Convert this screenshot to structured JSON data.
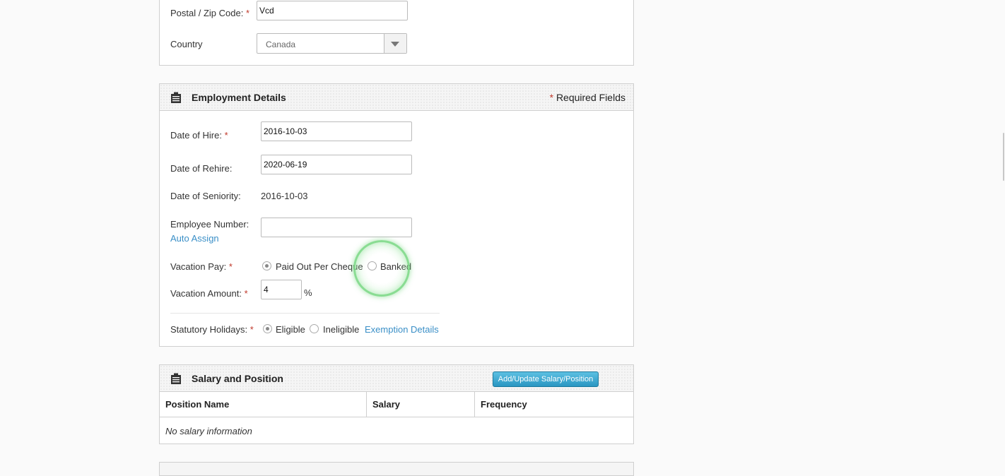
{
  "address": {
    "postal_label": "Postal / Zip Code:",
    "postal_value": "Vcd",
    "country_label": "Country",
    "country_value": "Canada"
  },
  "employment": {
    "title": "Employment Details",
    "required_note": "Required Fields",
    "required_star": "*",
    "hire_label": "Date of Hire:",
    "hire_value": "2016-10-03",
    "rehire_label": "Date of Rehire:",
    "rehire_value": "2020-06-19",
    "seniority_label": "Date of Seniority:",
    "seniority_value": "2016-10-03",
    "employee_number_label": "Employee Number:",
    "employee_number_value": "",
    "auto_assign_link": "Auto Assign",
    "vacation_pay_label": "Vacation Pay:",
    "vacation_pay_options": [
      "Paid Out Per Cheque",
      "Banked"
    ],
    "vacation_pay_selected": "Paid Out Per Cheque",
    "vacation_amount_label": "Vacation Amount:",
    "vacation_amount_value": "4",
    "vacation_amount_unit": "%",
    "stat_holidays_label": "Statutory Holidays:",
    "stat_holidays_options": [
      "Eligible",
      "Ineligible"
    ],
    "stat_holidays_selected": "Eligible",
    "exemption_link": "Exemption Details"
  },
  "salary": {
    "title": "Salary and Position",
    "add_button": "Add/Update Salary/Position",
    "columns": [
      "Position Name",
      "Salary",
      "Frequency"
    ],
    "empty_message": "No salary information"
  },
  "colors": {
    "required_star": "#c0392b",
    "link": "#3a8fc7",
    "button": "#2a96c2"
  }
}
